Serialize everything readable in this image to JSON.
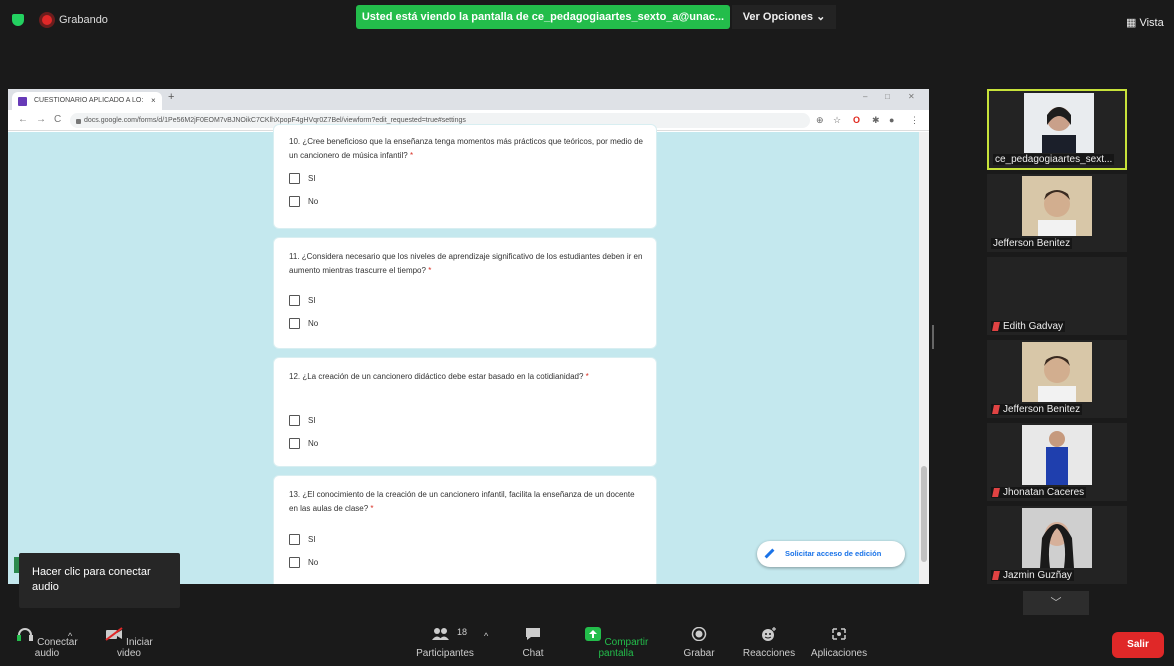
{
  "zoom": {
    "recording_label": "Grabando",
    "sharing_banner": "Usted está viendo la pantalla de ce_pedagogiaartes_sexto_a@unac...",
    "view_options": "Ver Opciones",
    "view_label": "Vista"
  },
  "browser": {
    "tab_title": "CUESTIONARIO APLICADO A LO:",
    "tab_close": "×",
    "new_tab": "+",
    "url": "docs.google.com/forms/d/1Pe56M2jF0EOM7vBJNOikC7CKlhXpopF4gHVqr0Z7Bel/viewform?edit_requested=true#settings",
    "win_min": "–",
    "win_max": "□",
    "win_close": "✕",
    "chrome_dots": "⋮",
    "ext_share": "⊕",
    "ext_star": "☆",
    "ext_opera": "O",
    "ext_puzzle": "✱",
    "ext_user": "●",
    "nav_back": "←",
    "nav_fwd": "→",
    "nav_reload": "C"
  },
  "form": {
    "questions": [
      {
        "text": "10. ¿Cree beneficioso que la enseñanza tenga momentos más prácticos que teóricos, por medio de un cancionero de música infantil?",
        "required": "*",
        "options": [
          "SI",
          "No"
        ]
      },
      {
        "text": "11. ¿Considera necesario que los niveles de aprendizaje significativo de los estudiantes deben ir en aumento mientras trascurre el tiempo?",
        "required": "*",
        "options": [
          "SI",
          "No"
        ]
      },
      {
        "text": "12. ¿La creación de un cancionero didáctico debe estar basado en la cotidianidad?",
        "required": "*",
        "options": [
          "SI",
          "No"
        ]
      },
      {
        "text": "13. ¿El conocimiento de la creación de un cancionero infantil, facilita la enseñanza de un docente en las aulas de clase?",
        "required": "*",
        "options": [
          "SI",
          "No"
        ]
      }
    ],
    "edit_button": "Solicitar acceso de edición"
  },
  "tooltip": "Hacer clic para conectar audio",
  "participants_list": [
    {
      "name": "ce_pedagogiaartes_sext...",
      "muted": false
    },
    {
      "name": "Jefferson Benitez",
      "muted": false
    },
    {
      "name": "Edith Gadvay",
      "muted": true
    },
    {
      "name": "Jefferson Benitez",
      "muted": true
    },
    {
      "name": "Jhonatan Caceres",
      "muted": true
    },
    {
      "name": "Jazmin Guzñay",
      "muted": true
    }
  ],
  "gallery_chevron": "﹀",
  "toolbar": {
    "audio": "Conectar audio",
    "video": "Iniciar video",
    "participants": "Participantes",
    "participant_count": "18",
    "chat": "Chat",
    "share": "Compartir pantalla",
    "record": "Grabar",
    "reactions": "Reacciones",
    "apps": "Aplicaciones",
    "leave": "Salir",
    "caret": "^"
  },
  "colors": {
    "share_green": "#23bd4b",
    "leave_red": "#e02828",
    "form_bg": "#c4e8ee",
    "active_border": "#c7e23a"
  }
}
